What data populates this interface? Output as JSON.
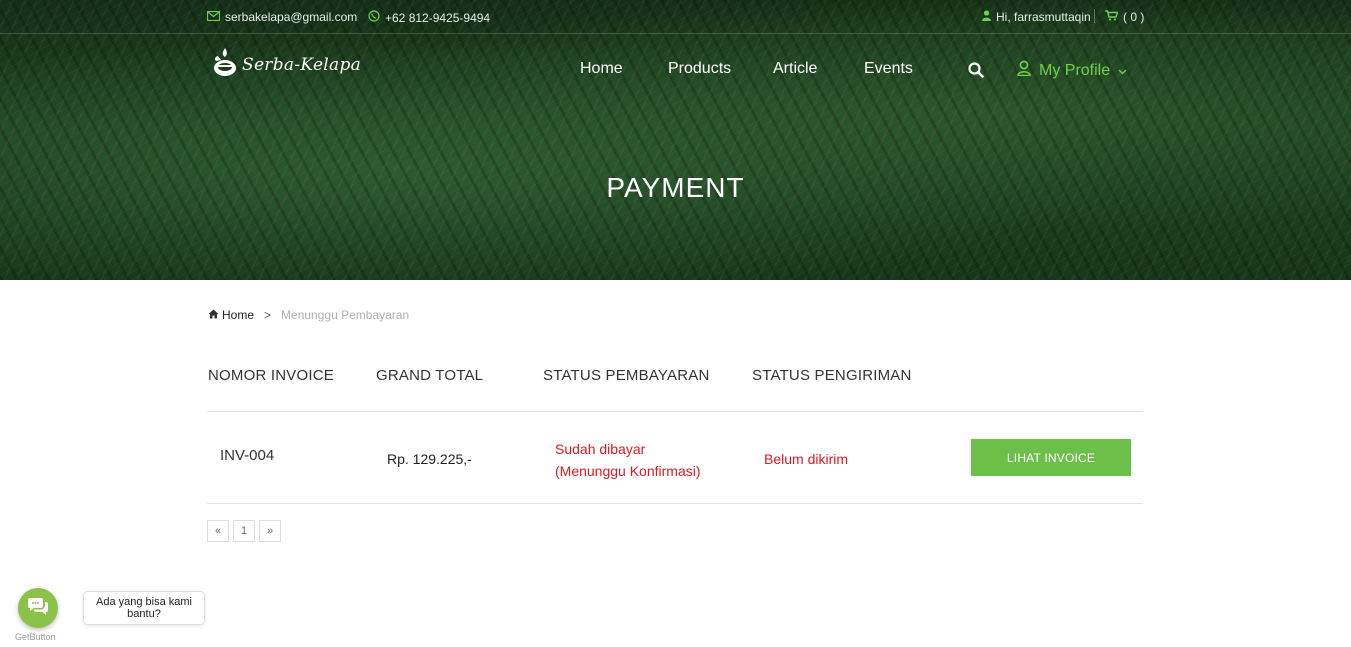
{
  "topbar": {
    "email": "serbakelapa@gmail.com",
    "phone": "+62 812-9425-9494",
    "greeting": "Hi, farrasmuttaqin",
    "cart_count": "( 0 )"
  },
  "brand": {
    "logo_text": "Serba-Kelapa"
  },
  "nav": {
    "items": [
      {
        "label": "Home"
      },
      {
        "label": "Products"
      },
      {
        "label": "Article"
      },
      {
        "label": "Events"
      }
    ],
    "profile_label": "My Profile"
  },
  "hero": {
    "title": "PAYMENT"
  },
  "breadcrumb": {
    "home": "Home",
    "separator": ">",
    "current": "Menunggu Pembayaran"
  },
  "table": {
    "headers": [
      "NOMOR INVOICE",
      "GRAND TOTAL",
      "STATUS PEMBAYARAN",
      "STATUS PENGIRIMAN"
    ],
    "rows": [
      {
        "invoice": "INV-004",
        "grand_total": "Rp. 129.225,-",
        "payment_status_line1": "Sudah dibayar",
        "payment_status_line2": "(Menunggu Konfirmasi)",
        "shipping_status": "Belum dikirim",
        "action_label": "LIHAT INVOICE"
      }
    ]
  },
  "pagination": {
    "prev": "«",
    "page": "1",
    "next": "»"
  },
  "chat_widget": {
    "message": "Ada yang bisa kami bantu?",
    "brand": "GetButton"
  },
  "colors": {
    "accent_green": "#6fcf4e",
    "button_green": "#6cc04a",
    "status_red": "#e0181f"
  }
}
